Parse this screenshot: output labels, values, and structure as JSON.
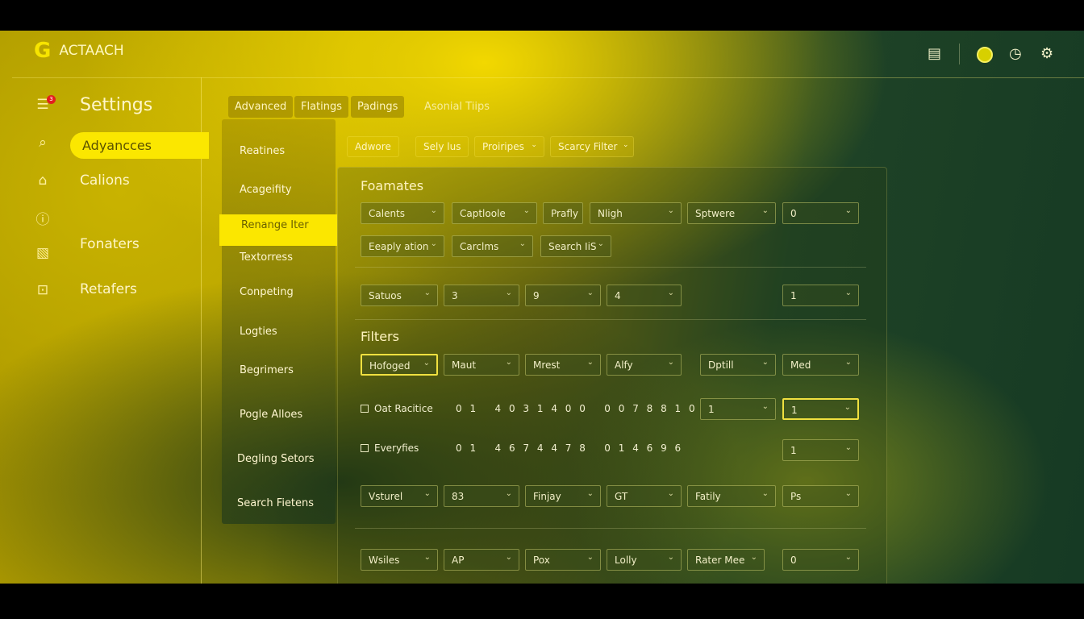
{
  "app": {
    "logo_letter": "G",
    "title": "ACTAACH"
  },
  "header_icons": [
    "book-icon",
    "status-icon",
    "clock-icon",
    "gear-icon"
  ],
  "sidebar": {
    "title": "Settings",
    "notification_count": "3",
    "items": [
      {
        "label": "Adyancces",
        "icon": "search-icon",
        "active": true
      },
      {
        "label": "Calions",
        "icon": "home-icon"
      },
      {
        "label": "",
        "icon": "info-icon"
      },
      {
        "label": "Fonaters",
        "icon": "image-icon"
      },
      {
        "label": "Retafers",
        "icon": "lock-icon"
      }
    ]
  },
  "tabs": [
    "Advanced",
    "Flatings",
    "Padings",
    "Asonial Tiips"
  ],
  "subtabs": [
    "Adwore",
    "Sely lus",
    "Proiripes",
    "Scarcy Filter"
  ],
  "submenu": [
    "Reatines",
    "Acageifity",
    "Renange Iter",
    "Textorress",
    "Conpeting",
    "Logties",
    "Begrimers",
    "Pogle Alloes",
    "Degling Setors",
    "Search Fietens"
  ],
  "submenu_active": "Renange Iter",
  "sections": {
    "formats": "Foamates",
    "filters": "Filters"
  },
  "rows": {
    "r1": [
      "Calents",
      "Captloole",
      "Prafly",
      "Nligh",
      "Sptwere",
      "0"
    ],
    "r2": [
      "Eeaply ation",
      "Carclms",
      "Search IiS"
    ],
    "r3": [
      "Satuos",
      "3",
      "9",
      "4",
      "1"
    ],
    "r4": [
      "Hofoged",
      "Maut",
      "Mrest",
      "Alfy",
      "Dptill",
      "Med"
    ],
    "r5": {
      "label": "Oat Racitice",
      "digits": "0 1   4 0 3 1 4 0 0   0 0 7 8 8 1 0",
      "dropdowns": [
        "1",
        "1"
      ],
      "checked": false
    },
    "r6": {
      "label": "Everyfies",
      "digits": "0 1   4 6 7 4 4 7 8   0 1 4 6 9 6",
      "dropdowns": [
        "1"
      ],
      "checked": false
    },
    "r7": [
      "Vsturel",
      "83",
      "Finjay",
      "GT",
      "Fatily",
      "Ps"
    ],
    "r8": [
      "Wsiles",
      "AP",
      "Pox",
      "Lolly",
      "Rater Mee",
      "0"
    ]
  },
  "colors": {
    "accent": "#fbe700",
    "bg_dark": "#163a24",
    "badge": "#e31e1e"
  }
}
